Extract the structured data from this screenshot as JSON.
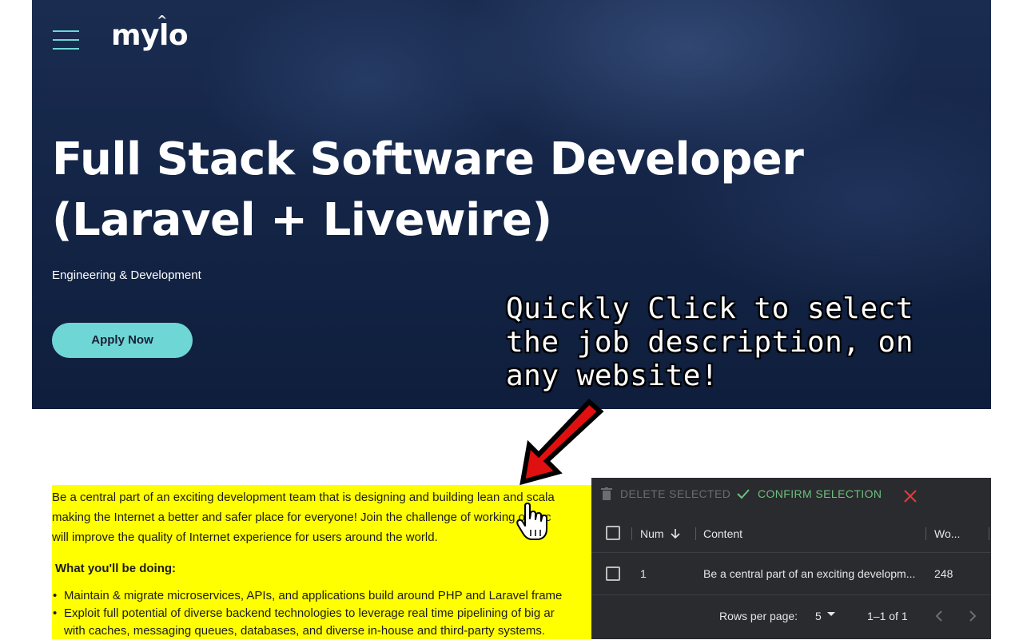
{
  "site": {
    "logo": "mylo",
    "logo_caret": "^"
  },
  "hero": {
    "title": "Full Stack Software Developer (Laravel + Livewire)",
    "department": "Engineering & Development",
    "apply_label": "Apply Now"
  },
  "callout": {
    "lines": [
      "Quickly Click to select",
      "the job description, on",
      "any website!"
    ]
  },
  "description": {
    "paragraph_lines": [
      "Be a central part of an exciting development team that is designing and building lean and scala",
      "making the Internet a better and safer place for everyone! Join the challenge of working on tec",
      "will improve the quality of Internet experience for users around the world."
    ],
    "heading": "What you'll be doing:",
    "bullets": [
      "Maintain & migrate microservices, APIs, and applications build around PHP and Laravel frame",
      "Exploit full potential of diverse backend technologies to leverage real time pipelining of big ar"
    ],
    "bullet_continuation": "with caches, messaging queues, databases, and diverse in-house and third-party systems."
  },
  "panel": {
    "delete_label": "DELETE SELECTED",
    "confirm_label": "CONFIRM SELECTION",
    "columns": {
      "num": "Num",
      "content": "Content",
      "words": "Wo..."
    },
    "rows": [
      {
        "num": "1",
        "content": "Be a central part of an exciting developm...",
        "words": "248"
      }
    ],
    "footer": {
      "rows_per_page_label": "Rows per page:",
      "rows_per_page": "5",
      "range": "1–1 of 1"
    }
  },
  "colors": {
    "hero_bg": "#142547",
    "accent": "#6fd6d6",
    "highlight": "#ffff00",
    "panel_bg": "#2a2b2f",
    "confirm": "#6ec07a",
    "close": "#e53935",
    "arrow": "#e01010"
  },
  "icons": [
    "menu-icon",
    "trash-icon",
    "check-icon",
    "close-icon",
    "arrow-down-icon",
    "chevron-left-icon",
    "chevron-right-icon",
    "pointer-hand-icon",
    "red-arrow-icon"
  ]
}
